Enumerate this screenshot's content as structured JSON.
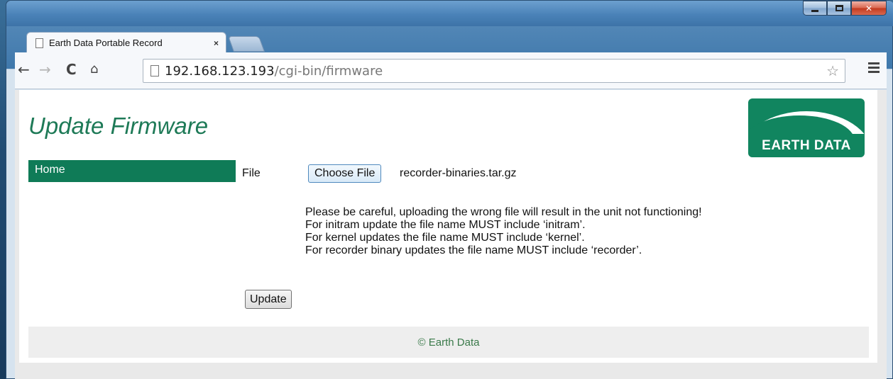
{
  "browser": {
    "tab_title": "Earth Data Portable Record",
    "tab_close": "×",
    "url_host": "192.168.123.193",
    "url_path": "/cgi-bin/firmware"
  },
  "page": {
    "title": "Update Firmware",
    "logo_text": "EARTH DATA",
    "nav": {
      "home": "Home"
    },
    "form": {
      "file_label": "File",
      "choose_button": "Choose File",
      "selected_file": "recorder-binaries.tar.gz",
      "notes": [
        "Please be careful, uploading the wrong file will result in the unit not functioning!",
        "For initram update the file name MUST include ‘initram’.",
        "For kernel updates the file name MUST include ‘kernel’.",
        "For recorder binary updates the file name MUST include ‘recorder’."
      ],
      "submit_button": "Update"
    },
    "footer": "© Earth Data"
  },
  "icons": {
    "back": "back-arrow-icon",
    "forward": "forward-arrow-icon",
    "reload": "reload-icon",
    "home": "home-icon",
    "page": "page-icon",
    "bookmark": "star-icon",
    "menu": "hamburger-menu-icon"
  },
  "colors": {
    "brand_green": "#11855f",
    "title_green": "#1e7a57",
    "footer_text": "#3a7a4a"
  }
}
